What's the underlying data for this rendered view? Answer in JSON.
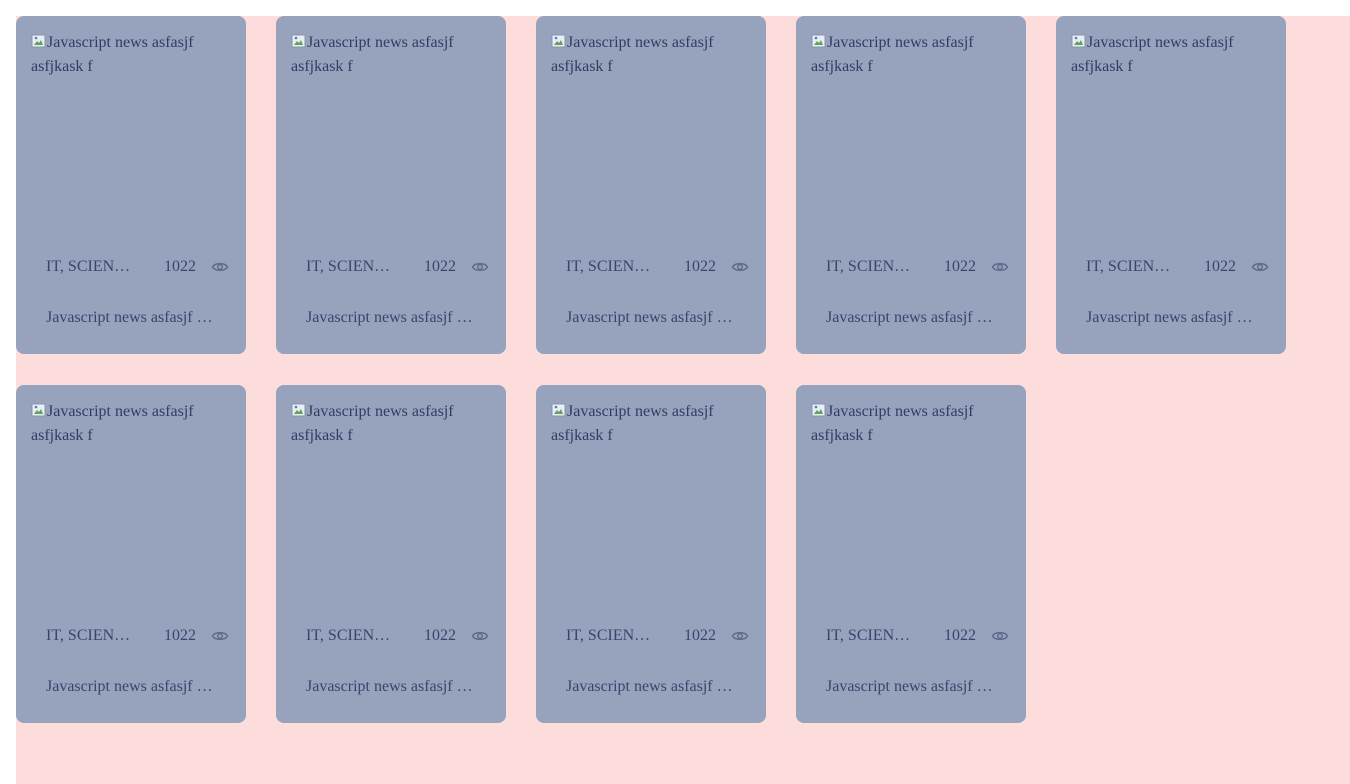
{
  "cards": [
    {
      "image_alt": "Javascript news asfasjf asfjkask f",
      "category": "IT, SCIENCE",
      "views": "1022",
      "title": "Javascript news asfasjf asfjkask f"
    },
    {
      "image_alt": "Javascript news asfasjf asfjkask f",
      "category": "IT, SCIENCE",
      "views": "1022",
      "title": "Javascript news asfasjf asfjkask f"
    },
    {
      "image_alt": "Javascript news asfasjf asfjkask f",
      "category": "IT, SCIENCE",
      "views": "1022",
      "title": "Javascript news asfasjf asfjkask f"
    },
    {
      "image_alt": "Javascript news asfasjf asfjkask f",
      "category": "IT, SCIENCE",
      "views": "1022",
      "title": "Javascript news asfasjf asfjkask f"
    },
    {
      "image_alt": "Javascript news asfasjf asfjkask f",
      "category": "IT, SCIENCE",
      "views": "1022",
      "title": "Javascript news asfasjf asfjkask f"
    },
    {
      "image_alt": "Javascript news asfasjf asfjkask f",
      "category": "IT, SCIENCE",
      "views": "1022",
      "title": "Javascript news asfasjf asfjkask f"
    },
    {
      "image_alt": "Javascript news asfasjf asfjkask f",
      "category": "IT, SCIENCE",
      "views": "1022",
      "title": "Javascript news asfasjf asfjkask f"
    },
    {
      "image_alt": "Javascript news asfasjf asfjkask f",
      "category": "IT, SCIENCE",
      "views": "1022",
      "title": "Javascript news asfasjf asfjkask f"
    },
    {
      "image_alt": "Javascript news asfasjf asfjkask f",
      "category": "IT, SCIENCE",
      "views": "1022",
      "title": "Javascript news asfasjf asfjkask f"
    }
  ],
  "icons": {
    "views": "eye-icon",
    "image_placeholder": "broken-image-icon"
  },
  "colors": {
    "page_background": "#fddcdc",
    "card_background": "#97a2bd",
    "text": "#36466c"
  }
}
